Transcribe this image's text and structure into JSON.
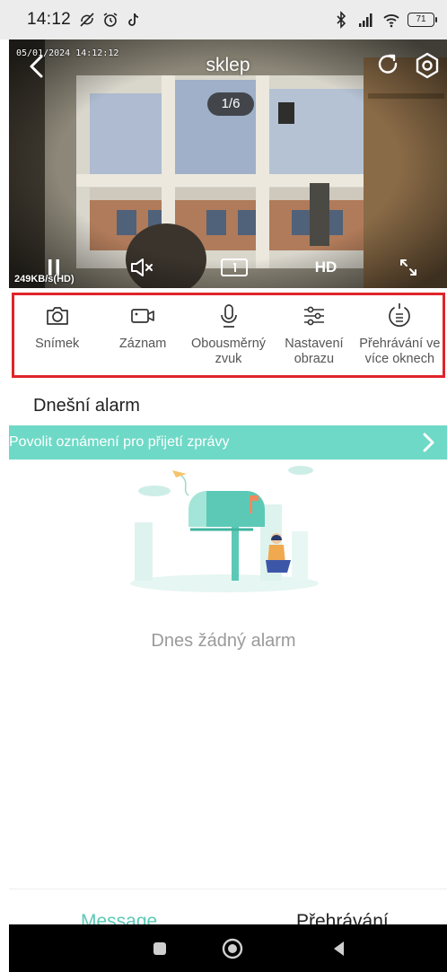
{
  "status_bar": {
    "time": "14:12",
    "battery": "71",
    "icons_left": [
      "no-sync-icon",
      "alarm-clock-icon",
      "tiktok-icon"
    ],
    "icons_right": [
      "bluetooth-icon",
      "signal-icon",
      "wifi-icon",
      "battery-icon"
    ]
  },
  "video": {
    "title": "sklep",
    "osd_timestamp": "05/01/2024 14:12:12",
    "page_indicator": "1/6",
    "quality": "HD",
    "bitrate": "249KB/s(HD)",
    "controls": [
      "pause-icon",
      "mute-icon",
      "screen-split-icon",
      "hd-toggle",
      "fullscreen-icon"
    ]
  },
  "toolbar": {
    "items": [
      {
        "label": "Snímek",
        "icon": "camera-icon"
      },
      {
        "label": "Záznam",
        "icon": "video-record-icon"
      },
      {
        "label": "Obousměrný\nzvuk",
        "icon": "microphone-icon"
      },
      {
        "label": "Nastavení\nobrazu",
        "icon": "sliders-icon"
      },
      {
        "label": "Přehrávání ve\nvíce oknech",
        "icon": "multi-playback-icon"
      }
    ]
  },
  "alarm": {
    "section_title": "Dnešní alarm",
    "notification_banner": "Povolit oznámení pro přijetí zprávy",
    "empty_text": "Dnes žádný alarm"
  },
  "tabs": {
    "message": "Message",
    "playback": "Přehrávání",
    "active": "message"
  },
  "colors": {
    "accent": "#5cc9b6",
    "banner": "#6ed9c6",
    "highlight_border": "#e0242a"
  }
}
